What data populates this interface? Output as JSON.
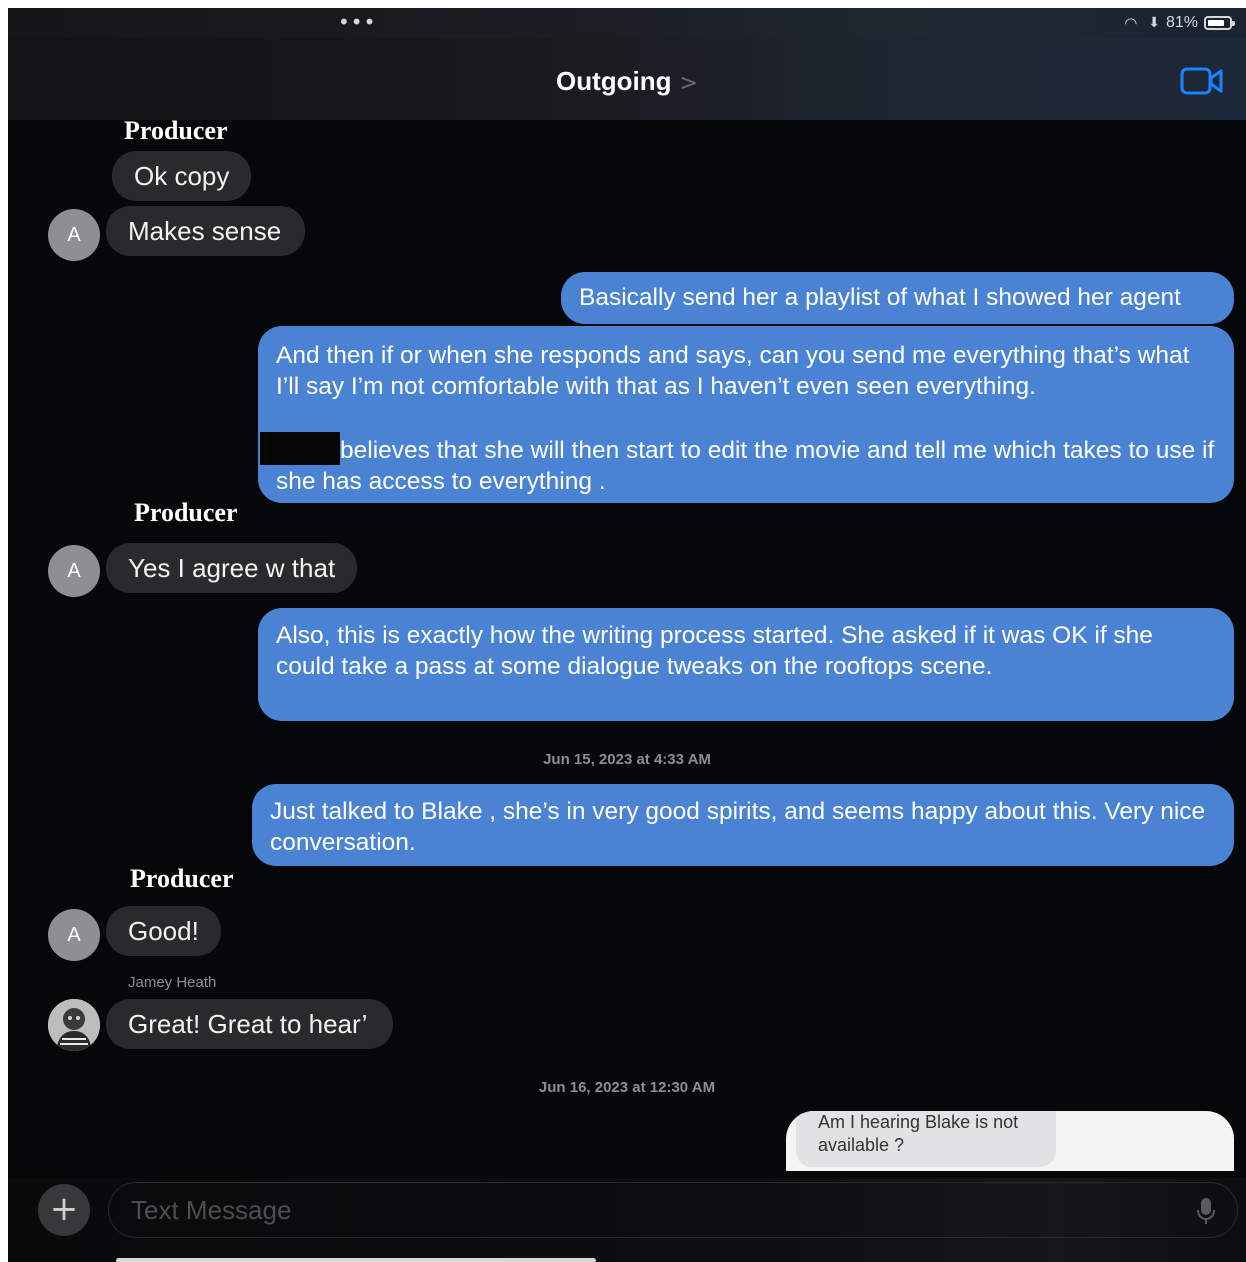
{
  "status_bar": {
    "dots": "•••",
    "battery": "81%",
    "battery_level": 0.81
  },
  "header": {
    "title": "Outgoing",
    "chevron": ">"
  },
  "messages": {
    "group1": {
      "sender": "Producer",
      "bubble1": "Ok copy",
      "bubble2": "Makes sense",
      "avatar": "A"
    },
    "out1": "Basically send her a playlist of what I showed her agent",
    "out2": {
      "para1": "And then if or when she responds and says, can you send me everything that’s what I’ll say I’m not comfortable with that as I haven’t even seen everything.",
      "para2_after_redaction": "believes that she will then start to edit the movie and tell me which takes to use if she has access to everything ."
    },
    "group2": {
      "sender": "Producer",
      "bubble": "Yes I agree w that",
      "avatar": "A"
    },
    "out3": "Also, this is exactly how the writing process started. She asked if it was OK if she could take a pass at some dialogue tweaks on the rooftops scene.",
    "timestamp1": "Jun 15, 2023 at 4:33 AM",
    "out4": "Just talked to Blake , she’s in very good spirits, and seems happy about this. Very nice conversation.",
    "group3": {
      "sender": "Producer",
      "bubble": "Good!",
      "avatar": "A"
    },
    "group4": {
      "sender": "Jamey Heath",
      "bubble": "Great!  Great to hear’"
    },
    "timestamp2": "Jun 16, 2023 at 12:30 AM",
    "forwarded": "Am I hearing Blake is not available ?"
  },
  "composer": {
    "plus": "+",
    "placeholder": "Text Message"
  },
  "colors": {
    "outgoing_bubble": "#4a83d3",
    "incoming_bubble": "#2a2a2d",
    "accent": "#1a84ff",
    "background": "#060709"
  }
}
